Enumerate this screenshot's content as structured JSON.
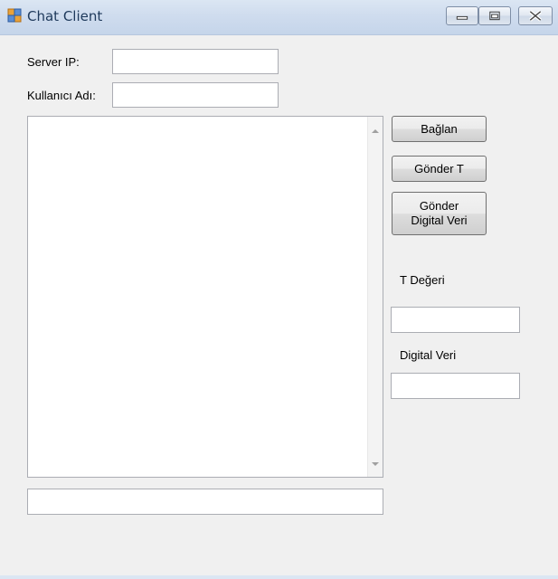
{
  "window": {
    "title": "Chat Client",
    "icon": "windows-form-icon"
  },
  "caption_buttons": {
    "minimize": "minimize-icon",
    "maximize": "maximize-icon",
    "close": "close-icon"
  },
  "form": {
    "server_ip_label": "Server IP:",
    "server_ip_value": "",
    "username_label": "Kullanıcı Adı:",
    "username_value": "",
    "message_value": "",
    "t_value_label": "T Değeri",
    "t_value": "",
    "digital_label": "Digital Veri",
    "digital_value": ""
  },
  "buttons": {
    "connect": "Bağlan",
    "send_t": "Gönder T",
    "send_digital_line1": "Gönder",
    "send_digital_line2": "Digital Veri"
  },
  "colors": {
    "title_text": "#1e395b",
    "window_bg": "#f0f0f0"
  }
}
